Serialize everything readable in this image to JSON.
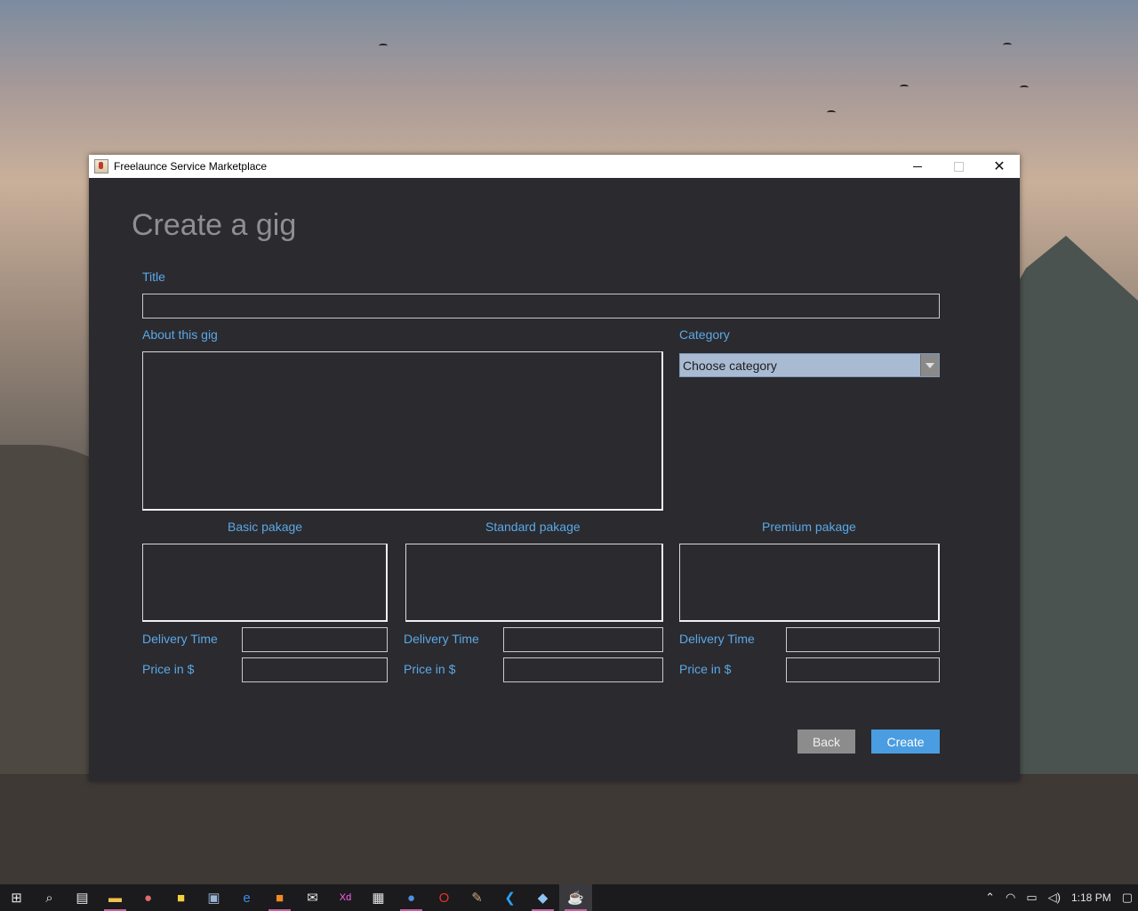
{
  "window": {
    "title": "Freelaunce Service Marketplace",
    "close_glyph": "✕"
  },
  "form": {
    "heading": "Create a gig",
    "title_label": "Title",
    "title_value": "",
    "about_label": "About this gig",
    "about_value": "",
    "category_label": "Category",
    "category_selected": "Choose category",
    "packages": [
      {
        "label": "Basic pakage",
        "delivery_label": "Delivery Time",
        "price_label": "Price in $"
      },
      {
        "label": "Standard pakage",
        "delivery_label": "Delivery Time",
        "price_label": "Price in $"
      },
      {
        "label": "Premium pakage",
        "delivery_label": "Delivery Time",
        "price_label": "Price in $"
      }
    ],
    "back_label": "Back",
    "create_label": "Create"
  },
  "colors": {
    "window_bg": "#2b2a2f",
    "label_blue": "#5aa9e6",
    "heading_gray": "#8e8e93",
    "create_btn": "#4a9de0",
    "back_btn": "#8c8c8c"
  },
  "taskbar": {
    "icons": [
      "windows-start-icon",
      "search-icon",
      "task-view-icon",
      "file-explorer-icon",
      "paint-icon",
      "sticky-notes-icon",
      "photos-icon",
      "edge-icon",
      "xampp-icon",
      "mail-icon",
      "adobe-xd-icon",
      "store-icon",
      "firefox-icon",
      "opera-icon",
      "paint-brush-icon",
      "vscode-icon",
      "virtualbox-icon",
      "java-app-icon"
    ],
    "clock": "1:18 PM"
  }
}
